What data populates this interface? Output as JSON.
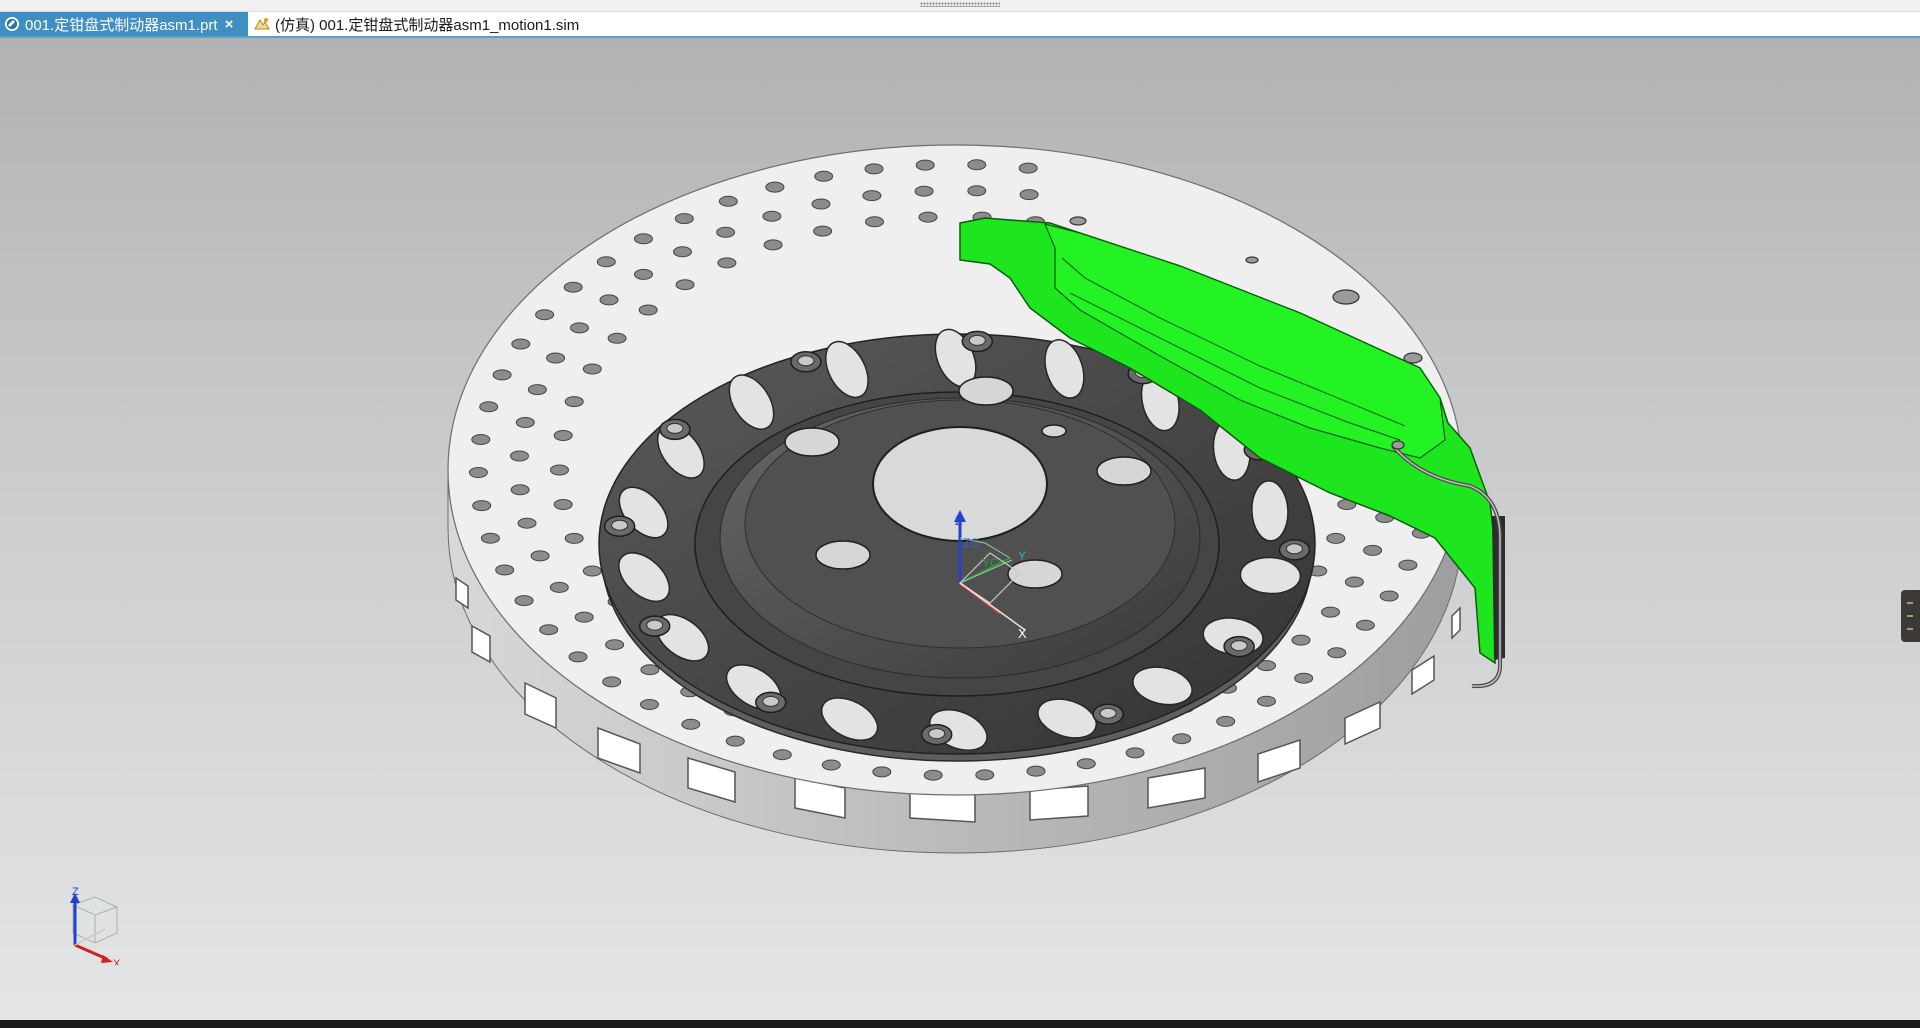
{
  "tabs": [
    {
      "label": "001.定钳盘式制动器asm1.prt",
      "active": true,
      "close": "×"
    },
    {
      "label": "(仿真) 001.定钳盘式制动器asm1_motion1.sim",
      "active": false
    }
  ],
  "wcs": {
    "z": "Z",
    "zc": "ZC",
    "yc": "YC",
    "y": "Y",
    "x": "X"
  },
  "triad": {
    "z": "Z",
    "x": "X"
  },
  "icons": [
    "part-file-icon",
    "close-icon",
    "simulation-file-icon",
    "triad-icon",
    "view-cube-icon"
  ],
  "colors": {
    "accent": "#3f8fc2",
    "caliper": "#1ee61e",
    "rotor": "#efefef",
    "hub": "#4a4a4a"
  }
}
